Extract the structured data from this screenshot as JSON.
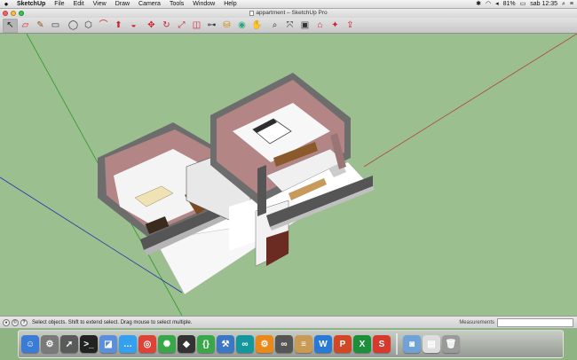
{
  "menubar": {
    "apple": "",
    "app_name": "SketchUp",
    "items": [
      "File",
      "Edit",
      "View",
      "Draw",
      "Camera",
      "Tools",
      "Window",
      "Help"
    ],
    "battery": "81%",
    "clock": "sab 12:35"
  },
  "window": {
    "title": "appartment – SketchUp Pro"
  },
  "toolbar": {
    "tools": [
      {
        "icon": "select-arrow-icon",
        "glyph": "↖"
      },
      {
        "icon": "eraser-icon",
        "glyph": "▱"
      },
      {
        "icon": "pencil-icon",
        "glyph": "✎"
      },
      {
        "icon": "rectangle-icon",
        "glyph": "▭"
      },
      {
        "icon": "circle-icon",
        "glyph": "◯"
      },
      {
        "icon": "polygon-icon",
        "glyph": "⬡"
      },
      {
        "icon": "arc-icon",
        "glyph": "⌒"
      },
      {
        "icon": "push-pull-icon",
        "glyph": "⬆"
      },
      {
        "icon": "follow-me-icon",
        "glyph": "◒"
      },
      {
        "icon": "move-icon",
        "glyph": "✥"
      },
      {
        "icon": "rotate-icon",
        "glyph": "↻"
      },
      {
        "icon": "scale-icon",
        "glyph": "⤢"
      },
      {
        "icon": "offset-icon",
        "glyph": "◫"
      },
      {
        "icon": "tape-measure-icon",
        "glyph": "⊶"
      },
      {
        "icon": "paint-bucket-icon",
        "glyph": "⛁"
      },
      {
        "icon": "orbit-icon",
        "glyph": "◉"
      },
      {
        "icon": "pan-icon",
        "glyph": "✋"
      },
      {
        "icon": "zoom-icon",
        "glyph": "⌕"
      },
      {
        "icon": "zoom-extents-icon",
        "glyph": "⤧"
      },
      {
        "icon": "components-icon",
        "glyph": "▣"
      },
      {
        "icon": "warehouse-icon",
        "glyph": "⌂"
      },
      {
        "icon": "extension-icon",
        "glyph": "✦"
      },
      {
        "icon": "share-model-icon",
        "glyph": "⇪"
      }
    ]
  },
  "statusbar": {
    "hint": "Select objects. Shift to extend select. Drag mouse to select multiple.",
    "measurements_label": "Measurements",
    "measurements_value": ""
  },
  "dock": {
    "items": [
      {
        "name": "finder",
        "glyph": "☺",
        "color": "#3a7bd5"
      },
      {
        "name": "system-preferences",
        "glyph": "⚙",
        "color": "#7a7a7a"
      },
      {
        "name": "rocket-launchpad",
        "glyph": "➚",
        "color": "#5a5a5a"
      },
      {
        "name": "terminal",
        "glyph": ">_",
        "color": "#222222"
      },
      {
        "name": "preview",
        "glyph": "◪",
        "color": "#5b8fd9"
      },
      {
        "name": "messages",
        "glyph": "…",
        "color": "#34a0ee"
      },
      {
        "name": "chrome",
        "glyph": "◎",
        "color": "#db4437"
      },
      {
        "name": "network-radar",
        "glyph": "✺",
        "color": "#3aa64a"
      },
      {
        "name": "unity",
        "glyph": "◆",
        "color": "#333333"
      },
      {
        "name": "brackets",
        "glyph": "{}",
        "color": "#3aa84a"
      },
      {
        "name": "xcode",
        "glyph": "⚒",
        "color": "#3b77c4"
      },
      {
        "name": "arduino",
        "glyph": "∞",
        "color": "#14979c"
      },
      {
        "name": "settings-gear",
        "glyph": "⚙",
        "color": "#e8891a"
      },
      {
        "name": "glasses",
        "glyph": "∞",
        "color": "#555555"
      },
      {
        "name": "notes-book",
        "glyph": "≡",
        "color": "#c89a55"
      },
      {
        "name": "word",
        "glyph": "W",
        "color": "#2b79d6"
      },
      {
        "name": "powerpoint",
        "glyph": "P",
        "color": "#d24726"
      },
      {
        "name": "excel",
        "glyph": "X",
        "color": "#1d8f3a"
      },
      {
        "name": "sketchup",
        "glyph": "S",
        "color": "#d63a2f"
      },
      {
        "name": "photo-browser",
        "glyph": "◙",
        "color": "#6fa2d6"
      },
      {
        "name": "documents",
        "glyph": "▤",
        "color": "#dddddd"
      },
      {
        "name": "trash",
        "glyph": "🗑",
        "color": "#9a9a9a"
      }
    ]
  }
}
